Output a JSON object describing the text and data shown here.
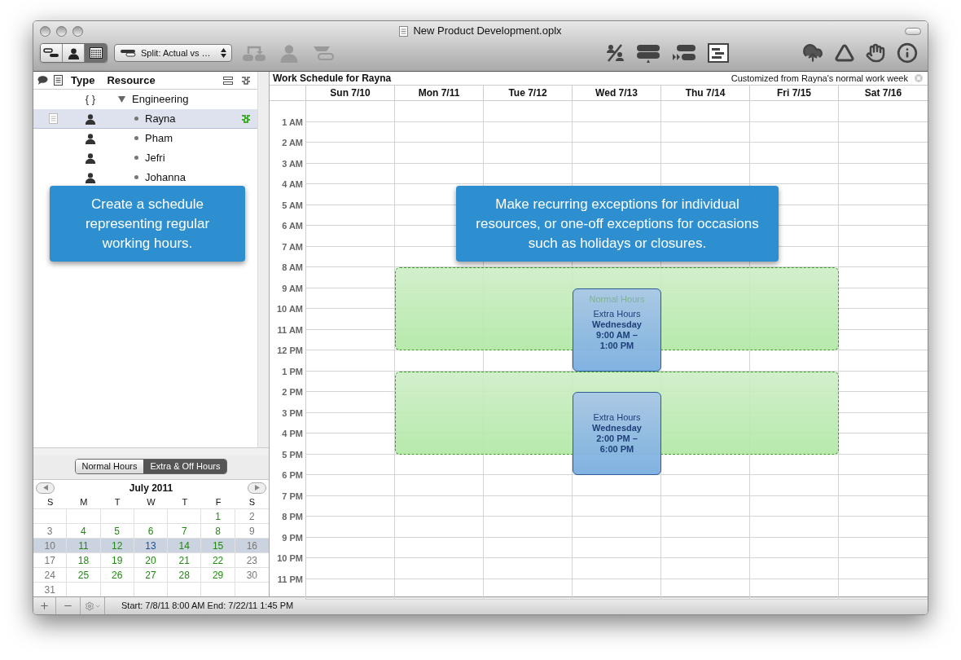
{
  "window": {
    "title": "New Product Development.oplx"
  },
  "toolbar": {
    "view_modes": [
      {
        "selected": false
      },
      {
        "selected": false
      },
      {
        "selected": true
      }
    ],
    "style_menu": "Split: Actual vs …"
  },
  "outline": {
    "columns": [
      "Type",
      "Resource"
    ],
    "rows": [
      {
        "kind": "group",
        "type_icon": "{ }",
        "name": "Engineering",
        "expanded": true,
        "selected": false,
        "children": [
          {
            "kind": "person",
            "name": "Rayna",
            "selected": true
          },
          {
            "kind": "person",
            "name": "Pham",
            "selected": false
          },
          {
            "kind": "person",
            "name": "Jefri",
            "selected": false
          },
          {
            "kind": "person",
            "name": "Johanna",
            "selected": false
          }
        ]
      }
    ]
  },
  "hours_tabs": [
    {
      "label": "Normal Hours",
      "selected": false
    },
    {
      "label": "Extra & Off Hours",
      "selected": true
    }
  ],
  "mini_calendar": {
    "title": "July 2011",
    "weekdays": [
      "S",
      "M",
      "T",
      "W",
      "T",
      "F",
      "S"
    ],
    "weeks": [
      {
        "selected": false,
        "starts_mid_week": true,
        "days": [
          {
            "day": "1",
            "kind": "work"
          },
          {
            "day": "2",
            "kind": "off"
          }
        ]
      },
      {
        "selected": false,
        "days": [
          {
            "day": "3",
            "kind": "off"
          },
          {
            "day": "4",
            "kind": "work"
          },
          {
            "day": "5",
            "kind": "work"
          },
          {
            "day": "6",
            "kind": "work"
          },
          {
            "day": "7",
            "kind": "work"
          },
          {
            "day": "8",
            "kind": "work"
          },
          {
            "day": "9",
            "kind": "off"
          }
        ]
      },
      {
        "selected": true,
        "days": [
          {
            "day": "10",
            "kind": "off"
          },
          {
            "day": "11",
            "kind": "work"
          },
          {
            "day": "12",
            "kind": "work"
          },
          {
            "day": "13",
            "kind": "extra"
          },
          {
            "day": "14",
            "kind": "work"
          },
          {
            "day": "15",
            "kind": "work"
          },
          {
            "day": "16",
            "kind": "off"
          }
        ]
      },
      {
        "selected": false,
        "days": [
          {
            "day": "17",
            "kind": "off"
          },
          {
            "day": "18",
            "kind": "work"
          },
          {
            "day": "19",
            "kind": "work"
          },
          {
            "day": "20",
            "kind": "work"
          },
          {
            "day": "21",
            "kind": "work"
          },
          {
            "day": "22",
            "kind": "work"
          },
          {
            "day": "23",
            "kind": "off"
          }
        ]
      },
      {
        "selected": false,
        "days": [
          {
            "day": "24",
            "kind": "off"
          },
          {
            "day": "25",
            "kind": "work"
          },
          {
            "day": "26",
            "kind": "work"
          },
          {
            "day": "27",
            "kind": "work"
          },
          {
            "day": "28",
            "kind": "work"
          },
          {
            "day": "29",
            "kind": "work"
          },
          {
            "day": "30",
            "kind": "off"
          }
        ]
      },
      {
        "selected": false,
        "days": [
          {
            "day": "31",
            "kind": "off"
          }
        ]
      }
    ]
  },
  "status_bar": "Start: 7/8/11 8:00 AM End: 7/22/11 1:45 PM",
  "schedule": {
    "title": "Work Schedule for Rayna",
    "note": "Customized from Rayna's normal work week",
    "days": [
      "Sun 7/10",
      "Mon 7/11",
      "Tue 7/12",
      "Wed 7/13",
      "Thu 7/14",
      "Fri 7/15",
      "Sat 7/16"
    ],
    "hours": [
      "1 AM",
      "2 AM",
      "3 AM",
      "4 AM",
      "5 AM",
      "6 AM",
      "7 AM",
      "8 AM",
      "9 AM",
      "10 AM",
      "11 AM",
      "12 PM",
      "1 PM",
      "2 PM",
      "3 PM",
      "4 PM",
      "5 PM",
      "6 PM",
      "7 PM",
      "8 PM",
      "9 PM",
      "10 PM",
      "11 PM"
    ],
    "blocks": [
      {
        "kind": "normal",
        "lines": [
          "Normal Hours"
        ]
      },
      {
        "kind": "normal"
      },
      {
        "kind": "extra",
        "lines": [
          "Extra Hours",
          "Wednesday",
          "9:00 AM –",
          "1:00 PM"
        ]
      },
      {
        "kind": "extra",
        "lines": [
          "Extra Hours",
          "Wednesday",
          "2:00 PM –",
          "6:00 PM"
        ]
      }
    ]
  },
  "callouts": [
    "Create a schedule representing regular working hours.",
    "Make recurring exceptions for individual resources, or one-off exceptions for occasions such as holidays or closures."
  ]
}
